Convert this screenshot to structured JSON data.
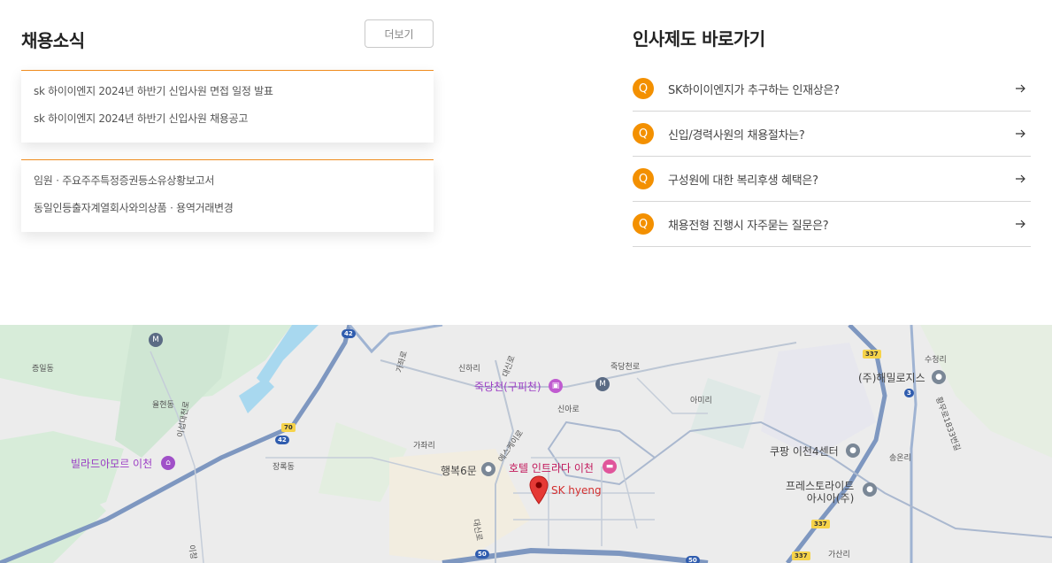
{
  "news": {
    "title": "채용소식",
    "more_label": "더보기",
    "recruit_items": [
      "sk 하이이엔지 2024년 하반기 신입사원 면접 일정 발표",
      "sk 하이이엔지 2024년 하반기 신입사원 채용공고"
    ],
    "disclosure_items": [
      "임원ㆍ주요주주특정증권등소유상황보고서",
      "동일인등출자계열회사와의상품ㆍ용역거래변경"
    ]
  },
  "hr": {
    "title": "인사제도 바로가기",
    "badge": "Q",
    "items": [
      "SK하이이엔지가 추구하는 인재상은?",
      "신입/경력사원의 채용절차는?",
      "구성원에 대한 복리후생 혜택은?",
      "채용전형 진행시 자주묻는 질문은?"
    ]
  },
  "map": {
    "marker_label": "SK hyeng",
    "pois": {
      "hotel": "호텔 인트라다 이천",
      "jukdangcheon": "죽당천(구피천)",
      "villa": "빌라드아모르 이천",
      "haengbok": "행복6문",
      "coupang": "쿠팡 이천4센터",
      "fresh": "프레스토라이트\n아시아(주)",
      "haemil": "(주)해밀로지스"
    },
    "places": {
      "jeungil": "증일동",
      "yulhyeon": "율현동",
      "jangnok": "장록동",
      "gajwa": "가좌리",
      "sinha": "신하리",
      "amiri": "아미리",
      "songjeong": "송온리",
      "sucheong": "수청리",
      "gasan": "가산리",
      "jukdangro": "죽당천로",
      "sinaro": "신아로",
      "eseukeiro": "에스케이로",
      "daesinro1": "대신로",
      "daesinro2": "대신로",
      "gajwaro": "가좌로",
      "idae": "이섭대천로",
      "ichang": "이창",
      "hwangmu": "황무로1833번길"
    },
    "shields": [
      "42",
      "42",
      "70",
      "337",
      "337",
      "337",
      "3",
      "50",
      "50"
    ],
    "colors": {
      "land": "#ececec",
      "green": "#cde8d2",
      "water": "#a8d8ef",
      "road": "#8aa4c8",
      "highway": "#6f8fbd"
    }
  }
}
